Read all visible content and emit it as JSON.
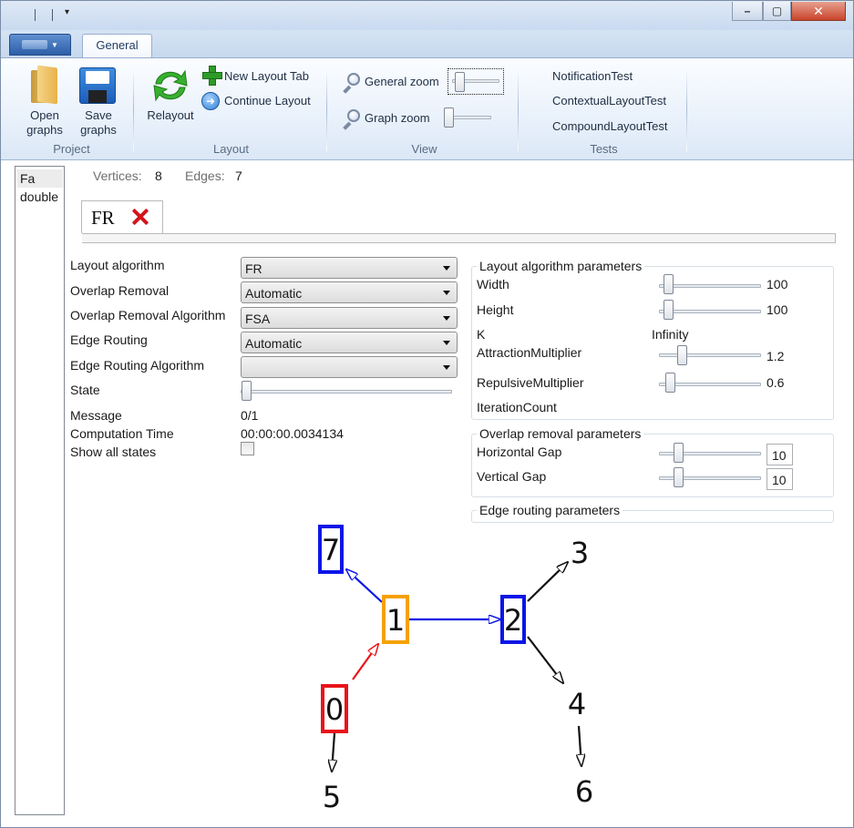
{
  "window": {
    "quick_access_arrow": "▾",
    "minimize_glyph": "–",
    "maximize_glyph": "▢",
    "close_glyph": "✕"
  },
  "ribbon": {
    "tabs": [
      {
        "label": "General"
      }
    ],
    "groups": {
      "project": {
        "label": "Project",
        "open_graphs": "Open\ngraphs",
        "save_graphs": "Save\ngraphs"
      },
      "layout": {
        "label": "Layout",
        "relayout": "Relayout",
        "new_layout_tab": "New Layout Tab",
        "continue_layout": "Continue Layout"
      },
      "view": {
        "label": "View",
        "general_zoom": "General zoom",
        "graph_zoom": "Graph zoom"
      },
      "tests": {
        "label": "Tests",
        "items": [
          "NotificationTest",
          "ContextualLayoutTest",
          "CompoundLayoutTest"
        ]
      }
    }
  },
  "left_list": {
    "items": [
      "Fa",
      "double"
    ]
  },
  "stats": {
    "vertices_label": "Vertices:",
    "vertices_value": "8",
    "edges_label": "Edges:",
    "edges_value": "7"
  },
  "doc_tab": {
    "title": "FR"
  },
  "layout_panel": {
    "rows": [
      {
        "label": "Layout algorithm",
        "value": "FR"
      },
      {
        "label": "Overlap Removal",
        "value": "Automatic"
      },
      {
        "label": "Overlap Removal Algorithm",
        "value": "FSA"
      },
      {
        "label": "Edge Routing",
        "value": "Automatic"
      },
      {
        "label": "Edge Routing Algorithm",
        "value": ""
      }
    ],
    "state_label": "State",
    "message_label": "Message",
    "message_value": "0/1",
    "computation_time_label": "Computation Time",
    "computation_time_value": "00:00:00.0034134",
    "show_all_states_label": "Show all states",
    "show_all_states_checked": false
  },
  "layout_params": {
    "title": "Layout algorithm parameters",
    "width_label": "Width",
    "width_value": "100",
    "height_label": "Height",
    "height_value": "100",
    "k_label": "K",
    "k_value": "Infinity",
    "attraction_label": "AttractionMultiplier",
    "attraction_value": "1.2",
    "repulsive_label": "RepulsiveMultiplier",
    "repulsive_value": "0.6",
    "iteration_label": "IterationCount"
  },
  "overlap_params": {
    "title": "Overlap removal parameters",
    "hgap_label": "Horizontal Gap",
    "hgap_value": "10",
    "vgap_label": "Vertical Gap",
    "vgap_value": "10"
  },
  "edge_routing_params": {
    "title": "Edge routing parameters"
  },
  "graph": {
    "vertices": [
      {
        "id": "0",
        "box": true,
        "color": "#e8141b"
      },
      {
        "id": "1",
        "box": true,
        "color": "#f5a100"
      },
      {
        "id": "2",
        "box": true,
        "color": "#0b16e6"
      },
      {
        "id": "3",
        "box": false,
        "color": "#111111"
      },
      {
        "id": "4",
        "box": false,
        "color": "#111111"
      },
      {
        "id": "5",
        "box": false,
        "color": "#111111"
      },
      {
        "id": "6",
        "box": false,
        "color": "#111111"
      },
      {
        "id": "7",
        "box": true,
        "color": "#0b16e6"
      }
    ],
    "edges": [
      {
        "from": "0",
        "to": "1",
        "color": "#e8141b"
      },
      {
        "from": "1",
        "to": "7",
        "color": "#0b16e6"
      },
      {
        "from": "1",
        "to": "2",
        "color": "#0b16e6"
      },
      {
        "from": "2",
        "to": "3",
        "color": "#111111"
      },
      {
        "from": "2",
        "to": "4",
        "color": "#111111"
      },
      {
        "from": "0",
        "to": "5",
        "color": "#111111"
      },
      {
        "from": "4",
        "to": "6",
        "color": "#111111"
      }
    ]
  }
}
